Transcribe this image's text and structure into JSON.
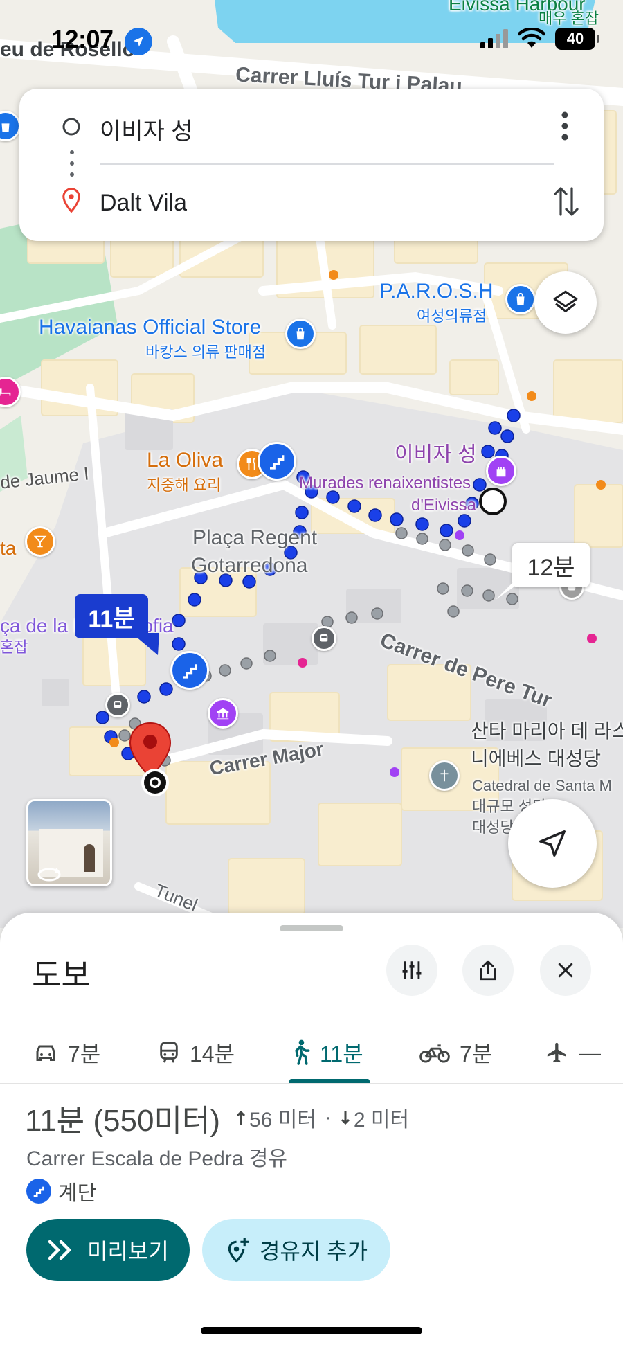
{
  "status_bar": {
    "time": "12:07",
    "battery": "40"
  },
  "route_search": {
    "origin": "이비자 성",
    "destination": "Dalt Vila"
  },
  "map": {
    "streets": {
      "rosello": "eu de Roselló",
      "lluis_tur": "Carrer Lluís Tur i Palau",
      "jaume": "de Jaume I",
      "pere_tur": "Carrer de Pere Tur",
      "major": "Carrer Major",
      "tunel": "Tunel",
      "harbour": "Eivissa Harbour"
    },
    "pois": {
      "harbour_sub": "매우 혼잡",
      "parosh": "P.A.R.O.S.H",
      "parosh_sub": "여성의류점",
      "havaianas": "Havaianas Official Store",
      "havaianas_sub": "바캉스 의류 판매점",
      "la_oliva": "La Oliva",
      "la_oliva_sub": "지중해 요리",
      "ibiza_castle": "이비자 성",
      "murades": "Murades renaixentistes",
      "murades_2": "d'Eivissa",
      "placa_regent": "Plaça Regent",
      "placa_regent_2": "Gotarredona",
      "placa_sofia": "ça de la Reina Sofia",
      "placa_sofia_sub": "혼잡",
      "ta": "ta",
      "cathedral_ko": "산타 마리아 데 라스",
      "cathedral_ko_2": "니에베스 대성당",
      "cathedral_en": "Catedral de Santa M",
      "cathedral_sub": "대규모 성당",
      "cathedral_sub_2": "대성당"
    },
    "route_times": {
      "selected": "11분",
      "alternative": "12분"
    },
    "colors": {
      "route_blue": "#1a40e8",
      "route_gray": "#9aa0a6",
      "pin_red": "#ea4335"
    }
  },
  "sheet": {
    "title": "도보",
    "modes": [
      {
        "icon": "car-icon",
        "label": "7분"
      },
      {
        "icon": "transit-icon",
        "label": "14분"
      },
      {
        "icon": "walk-icon",
        "label": "11분"
      },
      {
        "icon": "bike-icon",
        "label": "7분"
      },
      {
        "icon": "flight-icon",
        "label": "—"
      }
    ],
    "duration": "11분 (550미터)",
    "ascent": "56 미터",
    "descent": "2 미터",
    "separator": "·",
    "via": "Carrer Escala de Pedra 경유",
    "stairs_note": "계단",
    "preview_label": "미리보기",
    "add_waypoint_label": "경유지 추가"
  }
}
